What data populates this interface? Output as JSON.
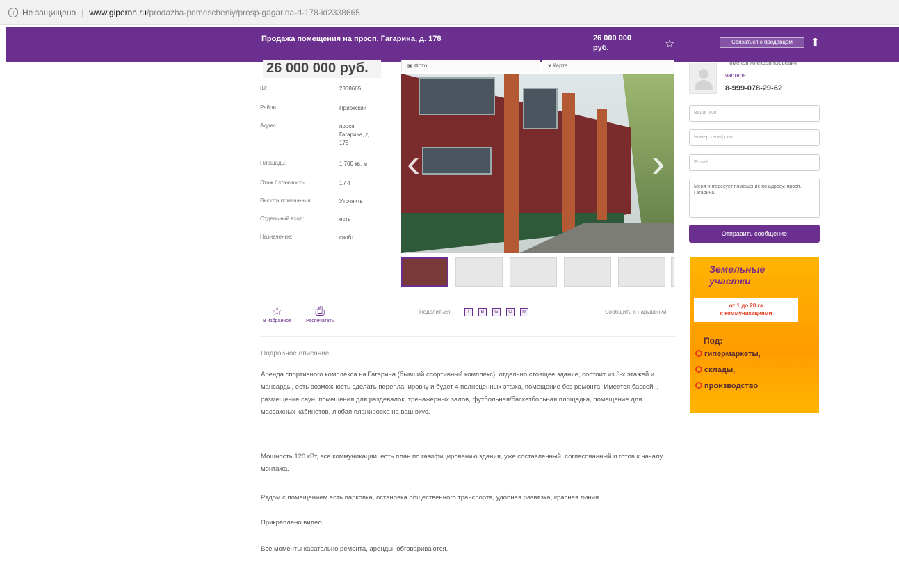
{
  "browser": {
    "security": "Не защищено",
    "domain": "www.gipernn.ru",
    "path": "/prodazha-pomescheniy/prosp-gagarina-d-178-id2338665"
  },
  "header": {
    "title": "Продажа помещения на просп. Гагарина, д. 178",
    "price": "26 000 000 руб.",
    "button": "Связаться с продавцом"
  },
  "listing": {
    "price": "26 000 000 руб.",
    "params": [
      {
        "k": "ID:",
        "v": "2338665"
      },
      {
        "k": "Район:",
        "v": "Приокский"
      },
      {
        "k": "Адрес:",
        "v": "просп. Гагарина, д. 178"
      },
      {
        "k": "Площадь:",
        "v": "1 700 кв. м"
      },
      {
        "k": "Этаж / этажность:",
        "v": "1 / 4"
      },
      {
        "k": "Высота помещения:",
        "v": "Уточнить"
      },
      {
        "k": "Отдельный вход:",
        "v": "есть"
      },
      {
        "k": "Назначение:",
        "v": "свобт"
      }
    ]
  },
  "gallery": {
    "tabs": [
      "Фото",
      "Карта"
    ],
    "prev": "‹",
    "next": "›"
  },
  "actions": {
    "favorite": "В избранное",
    "print": "Распечатать",
    "share_label": "Поделиться:",
    "share": [
      "f",
      "В",
      "G",
      "О",
      "М"
    ],
    "report": "Сообщить о нарушении"
  },
  "description": {
    "title": "Подробное описание",
    "paragraphs": [
      "Аренда спортивного комплекса на Гагарина (бывший спортивный комплекс), отдельно стоящее здание, состоит из 3-х этажей и мансарды, есть возможность сделать перепланировку и будет 4 полноценных этажа, помещение без ремонта. Имеется бассейн, размещение саун, помещения для раздевалок, тренажерных залов, футбольная/баскетбольная площадка, помещение для массажных кабинетов, любая планировка на ваш вкус.",
      "Мощность 120 кВт, все коммуникации, есть план по газифицированию здания, уже составленный, согласованный и готов к началу монтажа.",
      "Рядом с помещением есть парковка, остановка общественного транспорта, удобная развязка, красная линия.",
      "Прикреплено видео.",
      "Все моменты касательно ремонта, аренды, обговариваются."
    ]
  },
  "contact": {
    "name": "Тюменов Алексей Юрьевич",
    "agency": "частное",
    "phone": "8-999-078-29-62",
    "name_placeholder": "Ваше имя",
    "phone_placeholder": "Номер телефона",
    "email_placeholder": "E-mail",
    "message": "Меня интересует помещение по адресу: просп. Гагарина",
    "send": "Отправить сообщение"
  },
  "ad": {
    "title_line1": "Земельные",
    "title_line2": "участки",
    "ribbon_line1": "от 1 до 20 га",
    "ribbon_line2": "с коммуникациями",
    "pod": "Под:",
    "items": [
      "гипермаркеты,",
      "склады,",
      "производство"
    ]
  }
}
